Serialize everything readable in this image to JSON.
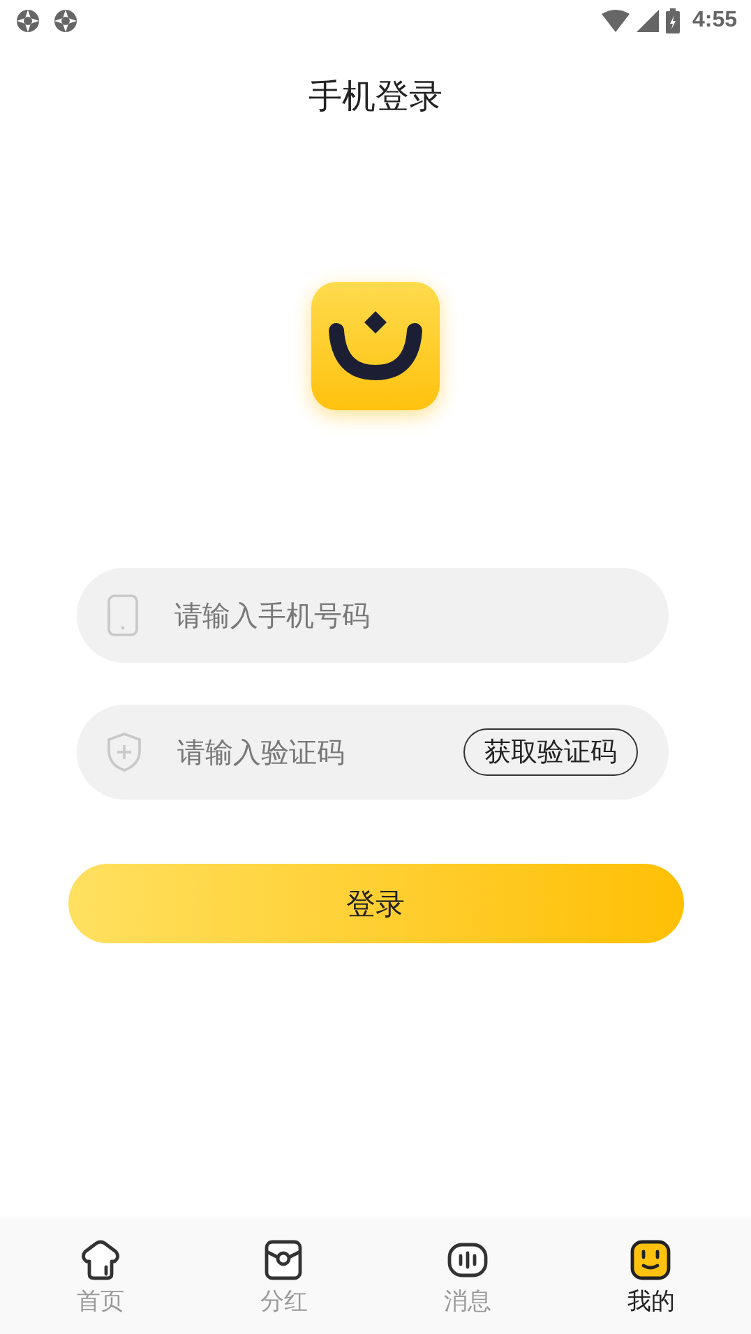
{
  "status_bar": {
    "time": "4:55"
  },
  "title": "手机登录",
  "phone_field": {
    "placeholder": "请输入手机号码"
  },
  "code_field": {
    "placeholder": "请输入验证码",
    "action": "获取验证码"
  },
  "login_button": "登录",
  "nav": [
    {
      "label": "首页",
      "kind": "home",
      "selected": false
    },
    {
      "label": "分红",
      "kind": "wallet",
      "selected": false
    },
    {
      "label": "消息",
      "kind": "message",
      "selected": false
    },
    {
      "label": "我的",
      "kind": "profile",
      "selected": true
    }
  ]
}
